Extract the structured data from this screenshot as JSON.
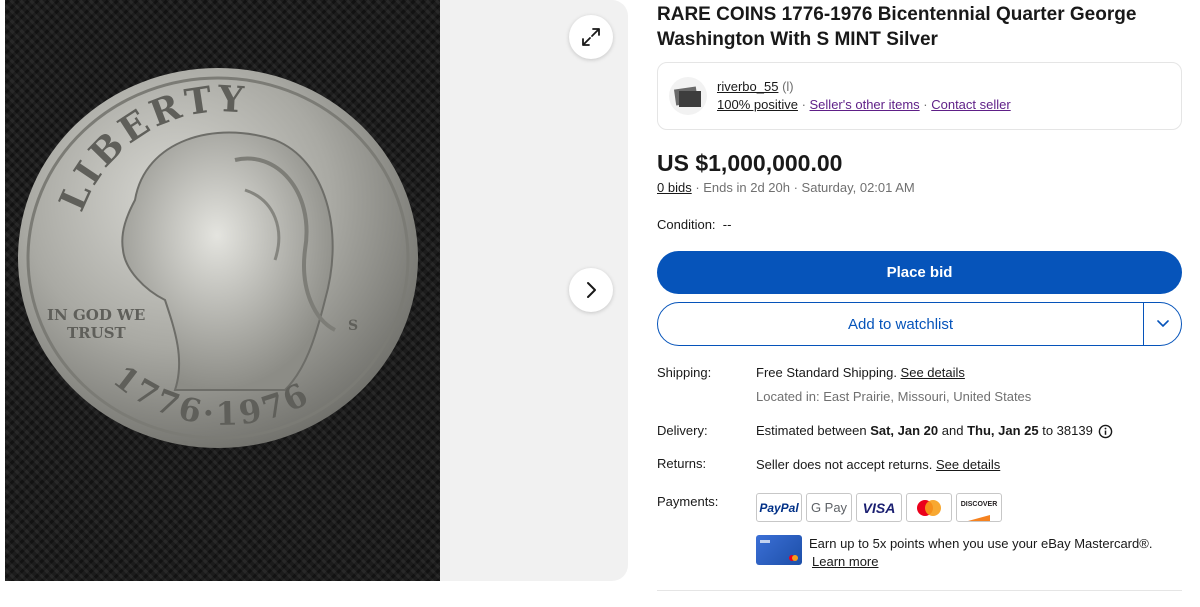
{
  "gallery": {
    "coin_top_text": "LIBERTY",
    "coin_motto_line1": "IN GOD WE",
    "coin_motto_line2": "TRUST",
    "coin_mint_mark": "S",
    "coin_years": "1776·1976",
    "expand_icon": "expand-arrows-icon",
    "next_icon": "chevron-right-icon"
  },
  "listing": {
    "title": "RARE COINS 1776-1976 Bicentennial Quarter George Washington With S MINT Silver"
  },
  "seller": {
    "name": "riverbo_55",
    "rating": "(l)",
    "feedback": "100% positive",
    "sep1": " · ",
    "other_items": "Seller's other items",
    "sep2": " · ",
    "contact": "Contact seller"
  },
  "price": {
    "amount": "US $1,000,000.00",
    "bids": "0 bids",
    "ends": " · Ends in 2d 20h · Saturday, 02:01 AM"
  },
  "condition": {
    "label": "Condition:",
    "value": "--"
  },
  "buttons": {
    "place_bid": "Place bid",
    "watchlist": "Add to watchlist"
  },
  "shipping": {
    "label": "Shipping:",
    "value": "Free Standard Shipping. ",
    "details": "See details",
    "location": "Located in: East Prairie, Missouri, United States"
  },
  "delivery": {
    "label": "Delivery:",
    "prefix": "Estimated between ",
    "start": "Sat, Jan 20",
    "and": " and ",
    "end": "Thu, Jan 25",
    "suffix": " to 38139"
  },
  "returns": {
    "label": "Returns:",
    "value": "Seller does not accept returns. ",
    "details": "See details"
  },
  "payments": {
    "label": "Payments:",
    "methods": [
      "PayPal",
      "G Pay",
      "VISA",
      "",
      "DISCOVER"
    ],
    "earn_text": "Earn up to 5x points when you use your eBay Mastercard®.",
    "learn_more": "Learn more"
  },
  "colors": {
    "primary_blue": "#0654ba",
    "link_purple": "#5e1f87",
    "text": "#191919",
    "muted": "#707070"
  }
}
